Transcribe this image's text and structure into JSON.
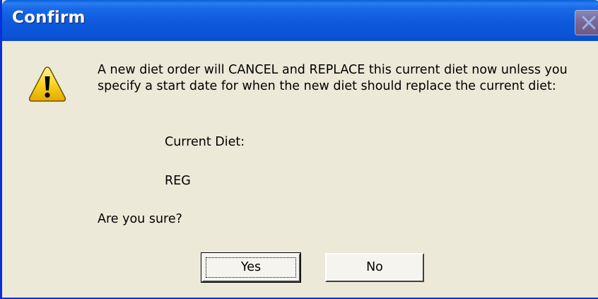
{
  "window": {
    "title": "Confirm"
  },
  "icons": {
    "warning": "warning-icon",
    "close": "close-icon"
  },
  "dialog": {
    "message": "A new diet order will CANCEL and REPLACE this current diet now unless you specify a start date for when the new diet should replace the current diet:",
    "current_diet_label": "Current Diet:",
    "current_diet_value": "REG",
    "question": "Are you sure?"
  },
  "buttons": {
    "yes_label": "Yes",
    "no_label": "No"
  },
  "colors": {
    "titlebar": "#0d58db",
    "dialog_background": "#ece9d8",
    "warning_yellow": "#f7d51d"
  }
}
